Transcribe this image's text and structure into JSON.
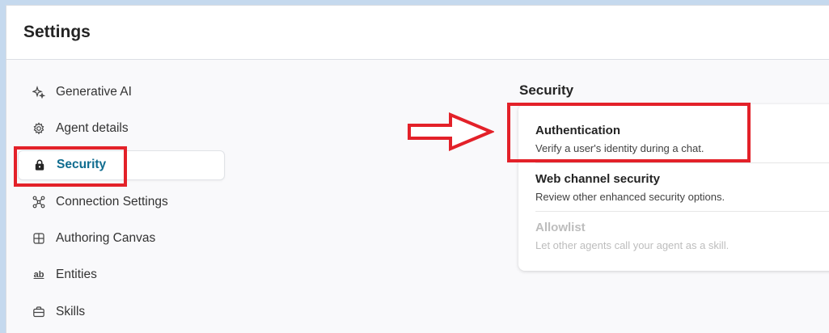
{
  "header": {
    "title": "Settings"
  },
  "nav": {
    "items": [
      {
        "label": "Generative AI",
        "icon": "sparkle-icon",
        "active": false
      },
      {
        "label": "Agent details",
        "icon": "gear-icon",
        "active": false
      },
      {
        "label": "Security",
        "icon": "lock-icon",
        "active": true
      },
      {
        "label": "Connection Settings",
        "icon": "connection-icon",
        "active": false
      },
      {
        "label": "Authoring Canvas",
        "icon": "grid-icon",
        "active": false
      },
      {
        "label": "Entities",
        "icon": "ab-icon",
        "active": false
      },
      {
        "label": "Skills",
        "icon": "briefcase-icon",
        "active": false
      }
    ],
    "entities_icon_text": "ab"
  },
  "security": {
    "title": "Security",
    "items": [
      {
        "title": "Authentication",
        "description": "Verify a user's identity during a chat.",
        "enabled": true
      },
      {
        "title": "Web channel security",
        "description": "Review other enhanced security options.",
        "enabled": true
      },
      {
        "title": "Allowlist",
        "description": "Let other agents call your agent as a skill.",
        "enabled": false
      }
    ]
  },
  "annotations": {
    "highlight_color": "#e32129",
    "accent_color": "#0f6c8f"
  }
}
